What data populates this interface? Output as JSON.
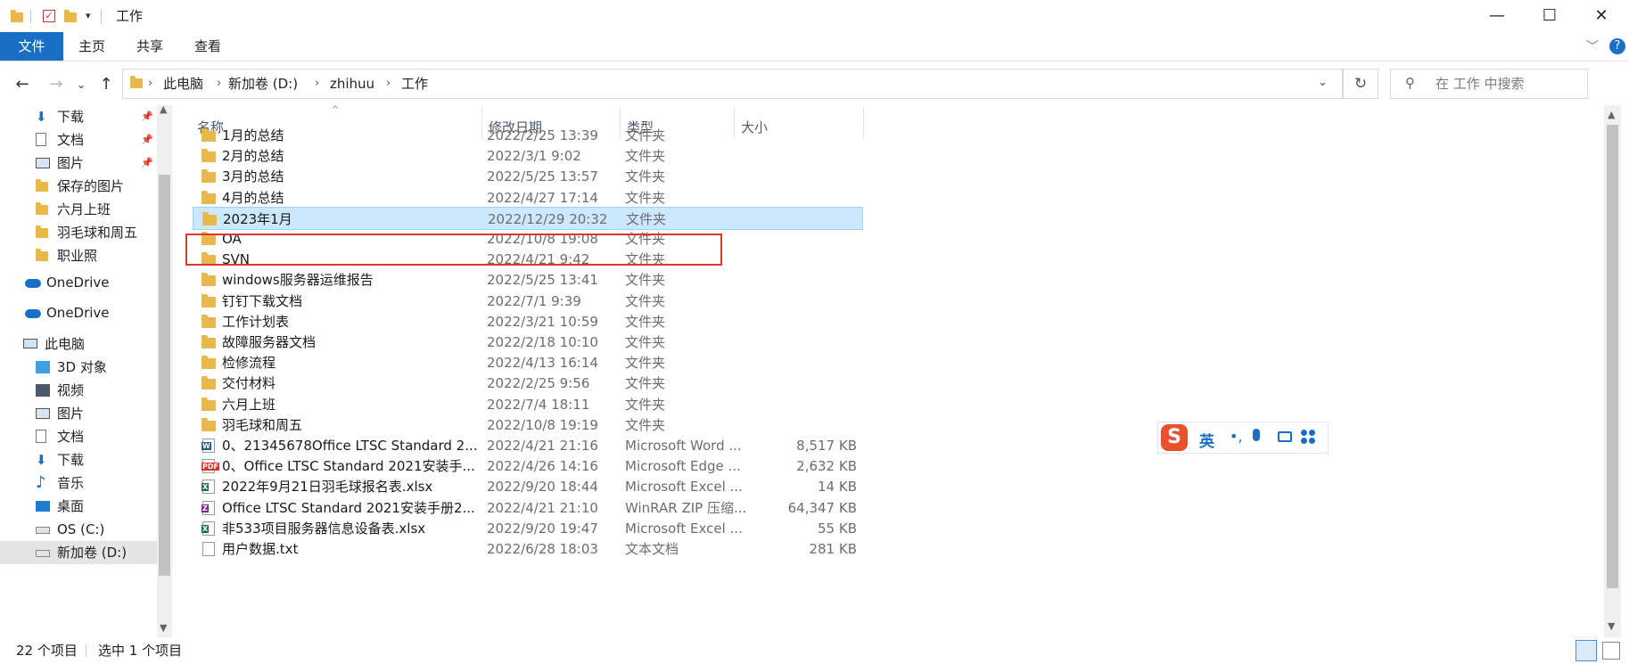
{
  "window": {
    "title": "工作",
    "minimize": "—",
    "maximize": "☐",
    "close": "✕"
  },
  "ribbon": {
    "tabs": [
      {
        "label": "文件",
        "active": true
      },
      {
        "label": "主页",
        "active": false
      },
      {
        "label": "共享",
        "active": false
      },
      {
        "label": "查看",
        "active": false
      }
    ]
  },
  "address": {
    "crumbs": [
      "此电脑",
      "新加卷 (D:)",
      "zhihuu",
      "工作"
    ],
    "search_placeholder": "在 工作 中搜索"
  },
  "sidebar": {
    "items": [
      {
        "label": "下载",
        "icon": "download-arrow-icon",
        "pinned": true
      },
      {
        "label": "文档",
        "icon": "document-icon",
        "pinned": true
      },
      {
        "label": "图片",
        "icon": "picture-icon",
        "pinned": true
      },
      {
        "label": "保存的图片",
        "icon": "folder-icon",
        "pinned": false
      },
      {
        "label": "六月上班",
        "icon": "folder-icon",
        "pinned": false
      },
      {
        "label": "羽毛球和周五",
        "icon": "folder-icon",
        "pinned": false
      },
      {
        "label": "职业照",
        "icon": "folder-icon",
        "pinned": false
      },
      {
        "label": "OneDrive",
        "icon": "cloud-icon",
        "pinned": false
      },
      {
        "label": "OneDrive",
        "icon": "cloud-icon",
        "pinned": false
      },
      {
        "label": "此电脑",
        "icon": "computer-icon",
        "pinned": false
      },
      {
        "label": "3D 对象",
        "icon": "cube-icon",
        "pinned": false
      },
      {
        "label": "视频",
        "icon": "video-icon",
        "pinned": false
      },
      {
        "label": "图片",
        "icon": "picture-icon",
        "pinned": false
      },
      {
        "label": "文档",
        "icon": "document-icon",
        "pinned": false
      },
      {
        "label": "下载",
        "icon": "download-arrow-icon",
        "pinned": false
      },
      {
        "label": "音乐",
        "icon": "music-note-icon",
        "pinned": false
      },
      {
        "label": "桌面",
        "icon": "desktop-icon",
        "pinned": false
      },
      {
        "label": "OS (C:)",
        "icon": "drive-icon",
        "pinned": false
      },
      {
        "label": "新加卷 (D:)",
        "icon": "drive-icon",
        "pinned": false
      }
    ]
  },
  "columns": {
    "name": "名称",
    "date": "修改日期",
    "type": "类型",
    "size": "大小"
  },
  "files": [
    {
      "name": "1月的总结",
      "date": "2022/2/25 13:39",
      "type": "文件夹",
      "size": "",
      "icon": "folder"
    },
    {
      "name": "2月的总结",
      "date": "2022/3/1 9:02",
      "type": "文件夹",
      "size": "",
      "icon": "folder"
    },
    {
      "name": "3月的总结",
      "date": "2022/5/25 13:57",
      "type": "文件夹",
      "size": "",
      "icon": "folder"
    },
    {
      "name": "4月的总结",
      "date": "2022/4/27 17:14",
      "type": "文件夹",
      "size": "",
      "icon": "folder"
    },
    {
      "name": "2023年1月",
      "date": "2022/12/29 20:32",
      "type": "文件夹",
      "size": "",
      "icon": "folder",
      "selected": true
    },
    {
      "name": "OA",
      "date": "2022/10/8 19:08",
      "type": "文件夹",
      "size": "",
      "icon": "folder"
    },
    {
      "name": "SVN",
      "date": "2022/4/21 9:42",
      "type": "文件夹",
      "size": "",
      "icon": "folder"
    },
    {
      "name": "windows服务器运维报告",
      "date": "2022/5/25 13:41",
      "type": "文件夹",
      "size": "",
      "icon": "folder"
    },
    {
      "name": "钉钉下载文档",
      "date": "2022/7/1 9:39",
      "type": "文件夹",
      "size": "",
      "icon": "folder"
    },
    {
      "name": "工作计划表",
      "date": "2022/3/21 10:59",
      "type": "文件夹",
      "size": "",
      "icon": "folder"
    },
    {
      "name": "故障服务器文档",
      "date": "2022/2/18 10:10",
      "type": "文件夹",
      "size": "",
      "icon": "folder"
    },
    {
      "name": "检修流程",
      "date": "2022/4/13 16:14",
      "type": "文件夹",
      "size": "",
      "icon": "folder"
    },
    {
      "name": "交付材料",
      "date": "2022/2/25 9:56",
      "type": "文件夹",
      "size": "",
      "icon": "folder"
    },
    {
      "name": "六月上班",
      "date": "2022/7/4 18:11",
      "type": "文件夹",
      "size": "",
      "icon": "folder"
    },
    {
      "name": "羽毛球和周五",
      "date": "2022/10/8 19:19",
      "type": "文件夹",
      "size": "",
      "icon": "folder"
    },
    {
      "name": "0、21345678Office LTSC Standard 2...",
      "date": "2022/4/21 21:16",
      "type": "Microsoft Word ...",
      "size": "8,517 KB",
      "icon": "word"
    },
    {
      "name": "0、Office LTSC Standard 2021安装手...",
      "date": "2022/4/26 14:16",
      "type": "Microsoft Edge ...",
      "size": "2,632 KB",
      "icon": "pdf"
    },
    {
      "name": "2022年9月21日羽毛球报名表.xlsx",
      "date": "2022/9/20 18:44",
      "type": "Microsoft Excel ...",
      "size": "14 KB",
      "icon": "excel"
    },
    {
      "name": "Office LTSC Standard 2021安装手册2...",
      "date": "2022/4/21 21:10",
      "type": "WinRAR ZIP 压缩...",
      "size": "64,347 KB",
      "icon": "zip"
    },
    {
      "name": "非533项目服务器信息设备表.xlsx",
      "date": "2022/9/20 19:47",
      "type": "Microsoft Excel ...",
      "size": "55 KB",
      "icon": "excel"
    },
    {
      "name": "用户数据.txt",
      "date": "2022/6/28 18:03",
      "type": "文本文档",
      "size": "281 KB",
      "icon": "txt"
    }
  ],
  "ime": {
    "logo": "S",
    "lang": "英"
  },
  "status": {
    "count": "22 个项目",
    "selected": "选中 1 个项目"
  },
  "colors": {
    "accent": "#1a6fc4",
    "selection": "#cce8ff",
    "highlight_box": "#e23434",
    "folder": "#e8b84a"
  }
}
